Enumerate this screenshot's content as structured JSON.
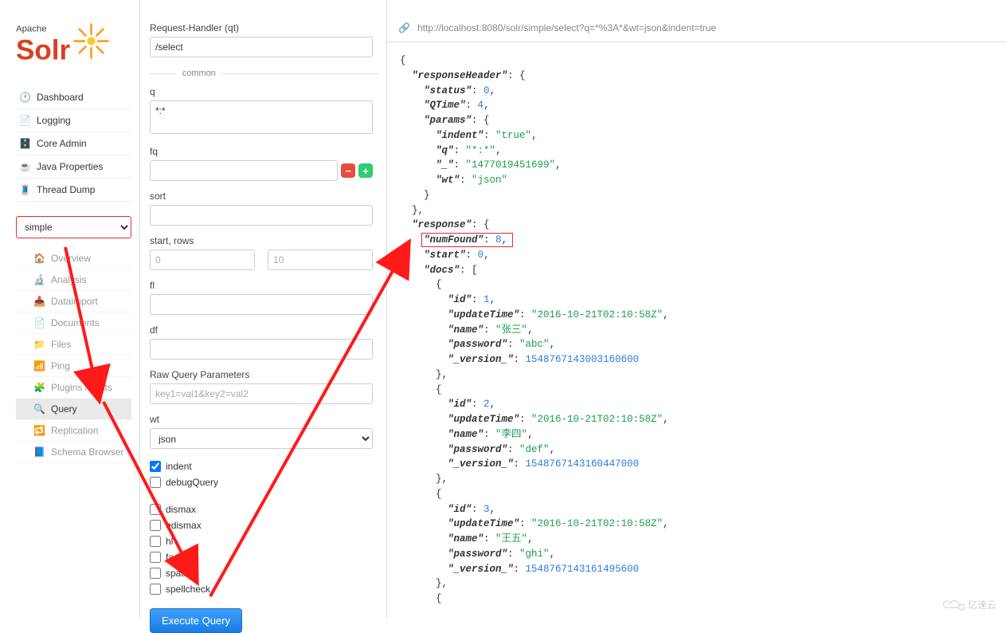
{
  "brand": {
    "top": "Apache",
    "name": "Solr"
  },
  "sidebar": {
    "nav": [
      {
        "label": "Dashboard"
      },
      {
        "label": "Logging"
      },
      {
        "label": "Core Admin"
      },
      {
        "label": "Java Properties"
      },
      {
        "label": "Thread Dump"
      }
    ],
    "core_selected": "simple",
    "sub": [
      {
        "label": "Overview"
      },
      {
        "label": "Analysis"
      },
      {
        "label": "Dataimport"
      },
      {
        "label": "Documents"
      },
      {
        "label": "Files"
      },
      {
        "label": "Ping"
      },
      {
        "label": "Plugins / Stats"
      },
      {
        "label": "Query"
      },
      {
        "label": "Replication"
      },
      {
        "label": "Schema Browser"
      }
    ]
  },
  "form": {
    "qt_label": "Request-Handler (qt)",
    "qt_value": "/select",
    "common_label": "common",
    "q_label": "q",
    "q_value": "*:*",
    "fq_label": "fq",
    "fq_value": "",
    "sort_label": "sort",
    "sort_value": "",
    "startrows_label": "start, rows",
    "start_ph": "0",
    "rows_ph": "10",
    "fl_label": "fl",
    "fl_value": "",
    "df_label": "df",
    "df_value": "",
    "raw_label": "Raw Query Parameters",
    "raw_ph": "key1=val1&key2=val2",
    "wt_label": "wt",
    "wt_value": "json",
    "indent_label": "indent",
    "debug_label": "debugQuery",
    "modules": [
      "dismax",
      "edismax",
      "hl",
      "facet",
      "spatial",
      "spellcheck"
    ],
    "execute_label": "Execute Query"
  },
  "result_url": "http://localhost:8080/solr/simple/select?q=*%3A*&wt=json&indent=true",
  "response": {
    "responseHeader": {
      "status": 0,
      "QTime": 4,
      "params": {
        "indent": "true",
        "q": "*:*",
        "_": "1477019451699",
        "wt": "json"
      }
    },
    "response": {
      "numFound": 8,
      "start": 0,
      "docs": [
        {
          "id": 1,
          "updateTime": "2016-10-21T02:10:58Z",
          "name": "张三",
          "password": "abc",
          "_version_": 1548767143003160600
        },
        {
          "id": 2,
          "updateTime": "2016-10-21T02:10:58Z",
          "name": "李四",
          "password": "def",
          "_version_": 1548767143160447000
        },
        {
          "id": 3,
          "updateTime": "2016-10-21T02:10:58Z",
          "name": "王五",
          "password": "ghi",
          "_version_": 1548767143161495600
        }
      ]
    }
  },
  "watermark": "亿速云"
}
